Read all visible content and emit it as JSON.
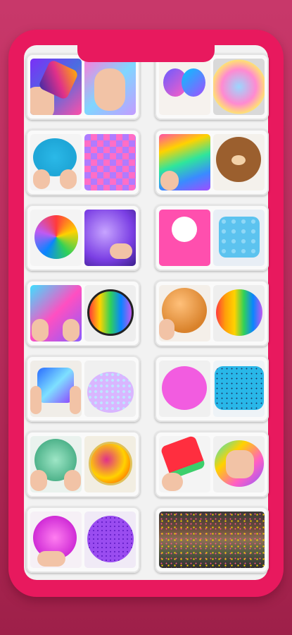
{
  "colors": {
    "background": "#c0325f",
    "frame": "#e8195e",
    "screen": "#f2f2f2",
    "card": "#fafafa"
  },
  "cards": [
    {
      "name": "slime-card-1",
      "left_icon": "rainbow-slice-slime",
      "right_icon": "hand-pastel-slime"
    },
    {
      "name": "slime-card-2",
      "left_icon": "bow-slime",
      "right_icon": "bubble-ball-slime"
    },
    {
      "name": "slime-card-3",
      "left_icon": "blue-dotted-slime",
      "right_icon": "checker-cube-slime"
    },
    {
      "name": "slime-card-4",
      "left_icon": "rainbow-bag-slime",
      "right_icon": "bear-face-slime"
    },
    {
      "name": "slime-card-5",
      "left_icon": "rainbow-squiggle-slime",
      "right_icon": "purple-glitter-slime"
    },
    {
      "name": "slime-card-6",
      "left_icon": "foam-cotton-slime",
      "right_icon": "blue-beads-slime"
    },
    {
      "name": "slime-card-7",
      "left_icon": "heart-slime",
      "right_icon": "rainbow-mesh-slime"
    },
    {
      "name": "slime-card-8",
      "left_icon": "orange-ball-slime",
      "right_icon": "rainbow-sprinkle-slime"
    },
    {
      "name": "slime-card-9",
      "left_icon": "holo-cube-slime",
      "right_icon": "foam-beads-slime"
    },
    {
      "name": "slime-card-10",
      "left_icon": "eyeball-slime",
      "right_icon": "blue-sprinkle-slime"
    },
    {
      "name": "slime-card-11",
      "left_icon": "clear-slime",
      "right_icon": "galaxy-ball-slime"
    },
    {
      "name": "slime-card-12",
      "left_icon": "watermelon-slime",
      "right_icon": "rainbow-hand-slime"
    },
    {
      "name": "slime-card-13",
      "left_icon": "pink-fluffy-slime",
      "right_icon": "purple-mesh-slime"
    },
    {
      "name": "slime-card-14",
      "left_icon": "collage-slime",
      "right_icon": ""
    }
  ]
}
